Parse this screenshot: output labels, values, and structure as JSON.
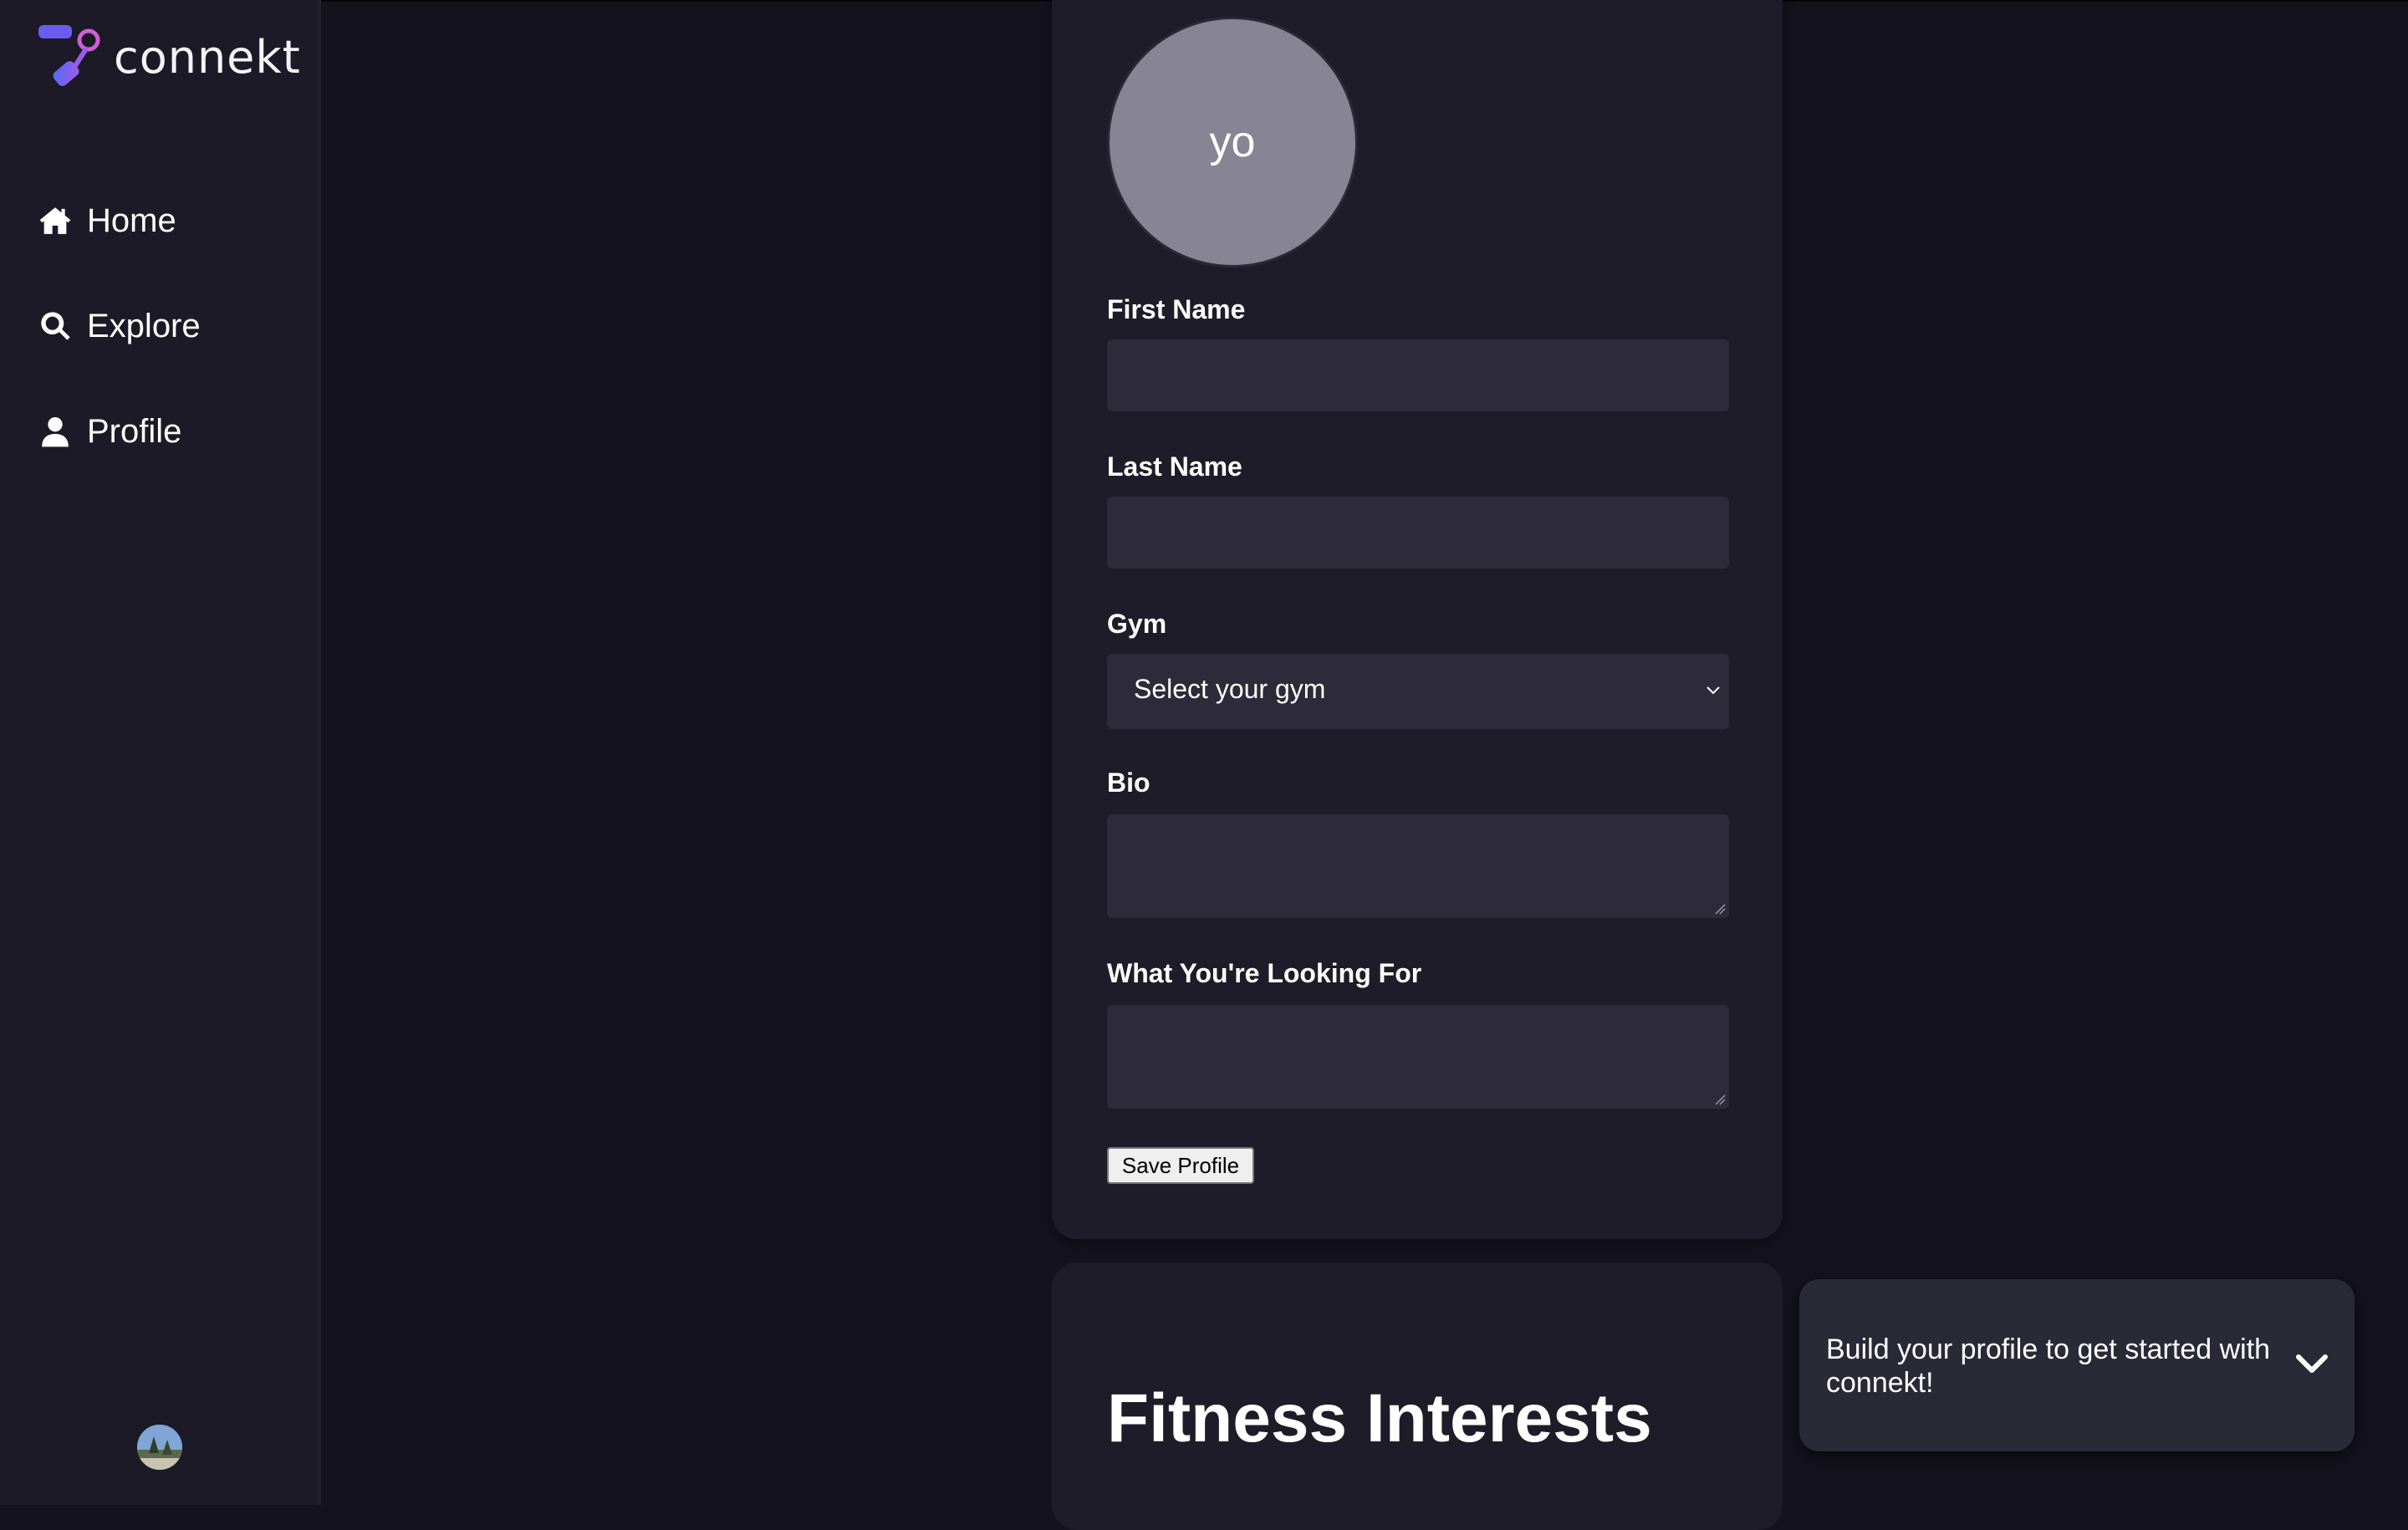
{
  "app": {
    "brand": "connekt",
    "colors": {
      "accent": "#8b5cf6",
      "accent_pink": "#d05fd8",
      "accent_blue": "#4f6bf5"
    }
  },
  "sidebar": {
    "items": [
      {
        "label": "Home",
        "icon": "home-icon"
      },
      {
        "label": "Explore",
        "icon": "search-icon"
      },
      {
        "label": "Profile",
        "icon": "user-icon"
      }
    ],
    "user_avatar_icon": "avatar"
  },
  "profile_form": {
    "avatar_initials": "yo",
    "first_name": {
      "label": "First Name",
      "value": ""
    },
    "last_name": {
      "label": "Last Name",
      "value": ""
    },
    "gym": {
      "label": "Gym",
      "selected": "Select your gym"
    },
    "bio": {
      "label": "Bio",
      "value": ""
    },
    "looking_for": {
      "label": "What You're Looking For",
      "value": ""
    },
    "save_label": "Save Profile"
  },
  "interests": {
    "title": "Fitness Interests"
  },
  "toast": {
    "message": "Build your profile to get started with connekt!",
    "icon": "chevron-down-icon"
  }
}
